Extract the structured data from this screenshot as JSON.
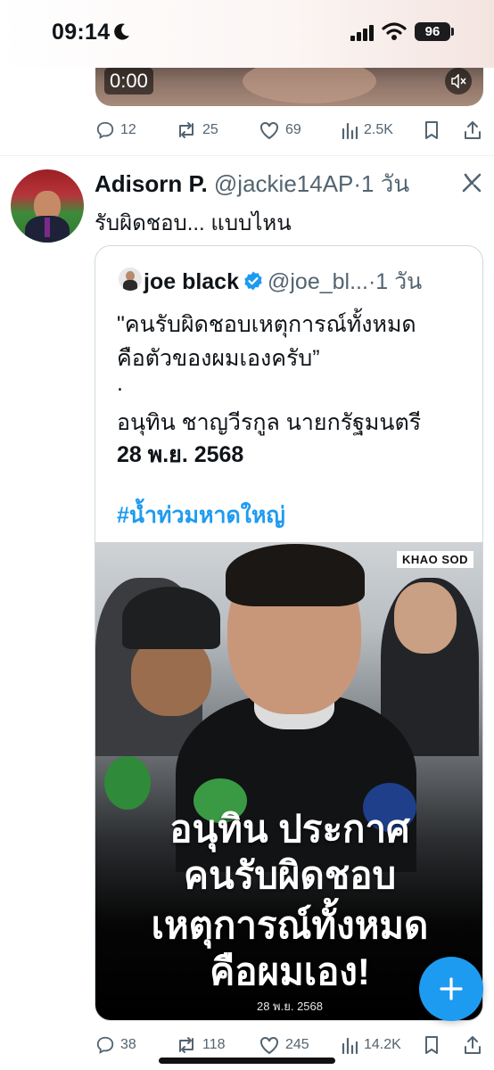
{
  "status_bar": {
    "time": "09:14",
    "battery": "96"
  },
  "previous_tweet": {
    "video_time": "0:00",
    "actions": {
      "replies": "12",
      "reposts": "25",
      "likes": "69",
      "views": "2.5K"
    }
  },
  "tweet": {
    "author_name": "Adisorn P.",
    "handle": "@jackie14AP",
    "time": "·1 วัน",
    "text": "รับผิดชอบ... แบบไหน",
    "quote": {
      "author_name": "joe black",
      "handle": "@joe_bl...",
      "time": "·1 วัน",
      "lines": [
        "\"คนรับผิดชอบเหตุการณ์ทั้งหมด",
        "คือตัวของผมเองครับ”",
        ".",
        "อนุทิน ชาญวีรกูล นายกรัฐมนตรี",
        "28 พ.ย. 2568"
      ],
      "hashtag": "#น้ำท่วมหาดใหญ่",
      "image": {
        "watermark": "KHAO SOD",
        "headline": [
          "อนุทิน ประกาศ",
          "คนรับผิดชอบ",
          "เหตุการณ์ทั้งหมด",
          "คือผมเอง!"
        ],
        "date": "28 พ.ย. 2568"
      }
    },
    "actions": {
      "replies": "38",
      "reposts": "118",
      "likes": "245",
      "views": "14.2K"
    }
  },
  "colors": {
    "accent": "#1d9bf0",
    "text": "#0f1419",
    "muted": "#536471"
  },
  "icons": [
    "moon-icon",
    "signal-icon",
    "wifi-icon",
    "mute-icon",
    "reply-icon",
    "repost-icon",
    "like-icon",
    "views-icon",
    "bookmark-icon",
    "share-icon",
    "grok-icon",
    "verified-icon",
    "plus-icon"
  ]
}
